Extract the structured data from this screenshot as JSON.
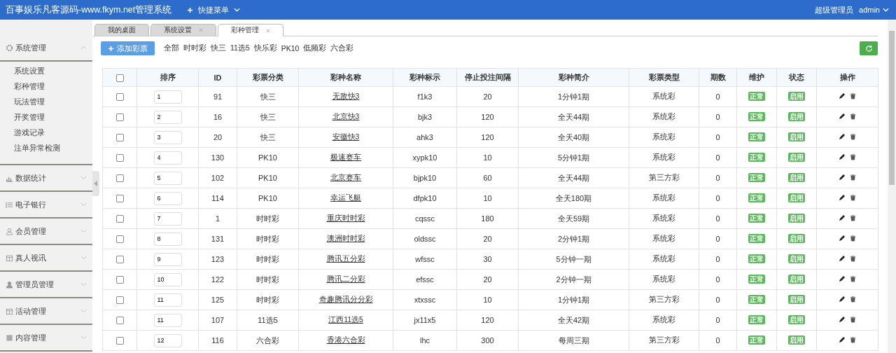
{
  "header": {
    "title": "百事娱乐凡客源码-www.fkym.net管理系统",
    "quick_menu": "快捷菜单",
    "role": "超级管理员",
    "user": "admin"
  },
  "sidebar": {
    "groups": [
      {
        "label": "系统管理",
        "expanded": true,
        "children": [
          {
            "label": "系统设置"
          },
          {
            "label": "彩种管理"
          },
          {
            "label": "玩法管理"
          },
          {
            "label": "开奖管理"
          },
          {
            "label": "游戏记录"
          },
          {
            "label": "注单异常检测"
          }
        ]
      },
      {
        "label": "数据统计",
        "expanded": false
      },
      {
        "label": "电子银行",
        "expanded": false
      },
      {
        "label": "会员管理",
        "expanded": false
      },
      {
        "label": "真人视讯",
        "expanded": false
      },
      {
        "label": "管理员管理",
        "expanded": false
      },
      {
        "label": "活动管理",
        "expanded": false
      },
      {
        "label": "内容管理",
        "expanded": false
      }
    ]
  },
  "tabs": [
    {
      "label": "我的桌面",
      "selected": false,
      "closable": false
    },
    {
      "label": "系统设置",
      "selected": false,
      "closable": true
    },
    {
      "label": "彩种管理",
      "selected": true,
      "closable": true
    }
  ],
  "toolbar": {
    "add_button": "添加彩票",
    "filters": [
      "全部",
      "时时彩",
      "快三",
      "11选5",
      "快乐彩",
      "PK10",
      "低频彩",
      "六合彩"
    ]
  },
  "table": {
    "columns": [
      "排序",
      "ID",
      "彩票分类",
      "彩种名称",
      "彩种标示",
      "停止投注间隔",
      "彩种简介",
      "彩票类型",
      "期数",
      "维护",
      "状态",
      "操作"
    ],
    "header_checked": false,
    "rows": [
      {
        "checked": false,
        "sort": "1",
        "id": "91",
        "category": "快三",
        "name": "无敌快3",
        "code": "f1k3",
        "interval": "20",
        "intro": "1分钟1期",
        "type": "系统彩",
        "periods": "0",
        "maintenance": "正常",
        "status": "启用"
      },
      {
        "checked": false,
        "sort": "2",
        "id": "16",
        "category": "快三",
        "name": "北京快3",
        "code": "bjk3",
        "interval": "120",
        "intro": "全天44期",
        "type": "系统彩",
        "periods": "0",
        "maintenance": "正常",
        "status": "启用"
      },
      {
        "checked": false,
        "sort": "3",
        "id": "20",
        "category": "快三",
        "name": "安徽快3",
        "code": "ahk3",
        "interval": "120",
        "intro": "全天40期",
        "type": "系统彩",
        "periods": "0",
        "maintenance": "正常",
        "status": "启用"
      },
      {
        "checked": false,
        "sort": "4",
        "id": "130",
        "category": "PK10",
        "name": "极速赛车",
        "code": "xypk10",
        "interval": "10",
        "intro": "5分钟1期",
        "type": "系统彩",
        "periods": "0",
        "maintenance": "正常",
        "status": "启用"
      },
      {
        "checked": false,
        "sort": "5",
        "id": "102",
        "category": "PK10",
        "name": "北京赛车",
        "code": "bjpk10",
        "interval": "60",
        "intro": "全天44期",
        "type": "第三方彩",
        "periods": "0",
        "maintenance": "正常",
        "status": "启用"
      },
      {
        "checked": false,
        "sort": "6",
        "id": "114",
        "category": "PK10",
        "name": "幸运飞艇",
        "code": "dfpk10",
        "interval": "10",
        "intro": "全天180期",
        "type": "系统彩",
        "periods": "0",
        "maintenance": "正常",
        "status": "启用"
      },
      {
        "checked": false,
        "sort": "7",
        "id": "1",
        "category": "时时彩",
        "name": "重庆时时彩",
        "code": "cqssc",
        "interval": "180",
        "intro": "全天59期",
        "type": "系统彩",
        "periods": "0",
        "maintenance": "正常",
        "status": "启用"
      },
      {
        "checked": false,
        "sort": "8",
        "id": "131",
        "category": "时时彩",
        "name": "澳洲时时彩",
        "code": "oldssc",
        "interval": "20",
        "intro": "2分钟1期",
        "type": "系统彩",
        "periods": "0",
        "maintenance": "正常",
        "status": "启用"
      },
      {
        "checked": false,
        "sort": "9",
        "id": "123",
        "category": "时时彩",
        "name": "腾讯五分彩",
        "code": "wfssc",
        "interval": "30",
        "intro": "5分钟一期",
        "type": "系统彩",
        "periods": "0",
        "maintenance": "正常",
        "status": "启用"
      },
      {
        "checked": false,
        "sort": "10",
        "id": "122",
        "category": "时时彩",
        "name": "腾讯二分彩",
        "code": "efssc",
        "interval": "20",
        "intro": "2分钟一期",
        "type": "系统彩",
        "periods": "0",
        "maintenance": "正常",
        "status": "启用"
      },
      {
        "checked": false,
        "sort": "11",
        "id": "125",
        "category": "时时彩",
        "name": "奇趣腾讯分分彩",
        "code": "xtxssc",
        "interval": "10",
        "intro": "1分钟1期",
        "type": "第三方彩",
        "periods": "0",
        "maintenance": "正常",
        "status": "启用"
      },
      {
        "checked": false,
        "sort": "11",
        "id": "107",
        "category": "11选5",
        "name": "江西11选5",
        "code": "jx11x5",
        "interval": "120",
        "intro": "全天42期",
        "type": "系统彩",
        "periods": "0",
        "maintenance": "正常",
        "status": "启用"
      },
      {
        "checked": false,
        "sort": "12",
        "id": "116",
        "category": "六合彩",
        "name": "香港六合彩",
        "code": "lhc",
        "interval": "300",
        "intro": "每周三期",
        "type": "第三方彩",
        "periods": "0",
        "maintenance": "正常",
        "status": "启用"
      }
    ]
  }
}
